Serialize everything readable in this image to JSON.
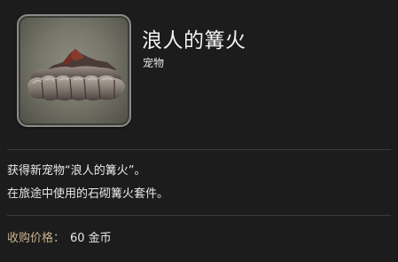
{
  "item": {
    "name": "浪人的篝火",
    "category": "宠物",
    "icon": "campfire-rock-icon"
  },
  "description": {
    "line1": "获得新宠物“浪人的篝火”。",
    "line2": "在旅途中使用的石砌篝火套件。"
  },
  "price": {
    "label": "收购价格：",
    "value": "60",
    "unit": "金币"
  },
  "colors": {
    "background": "#1c1c1c",
    "price_label": "#c9b48a",
    "text": "#e8e8e8"
  }
}
